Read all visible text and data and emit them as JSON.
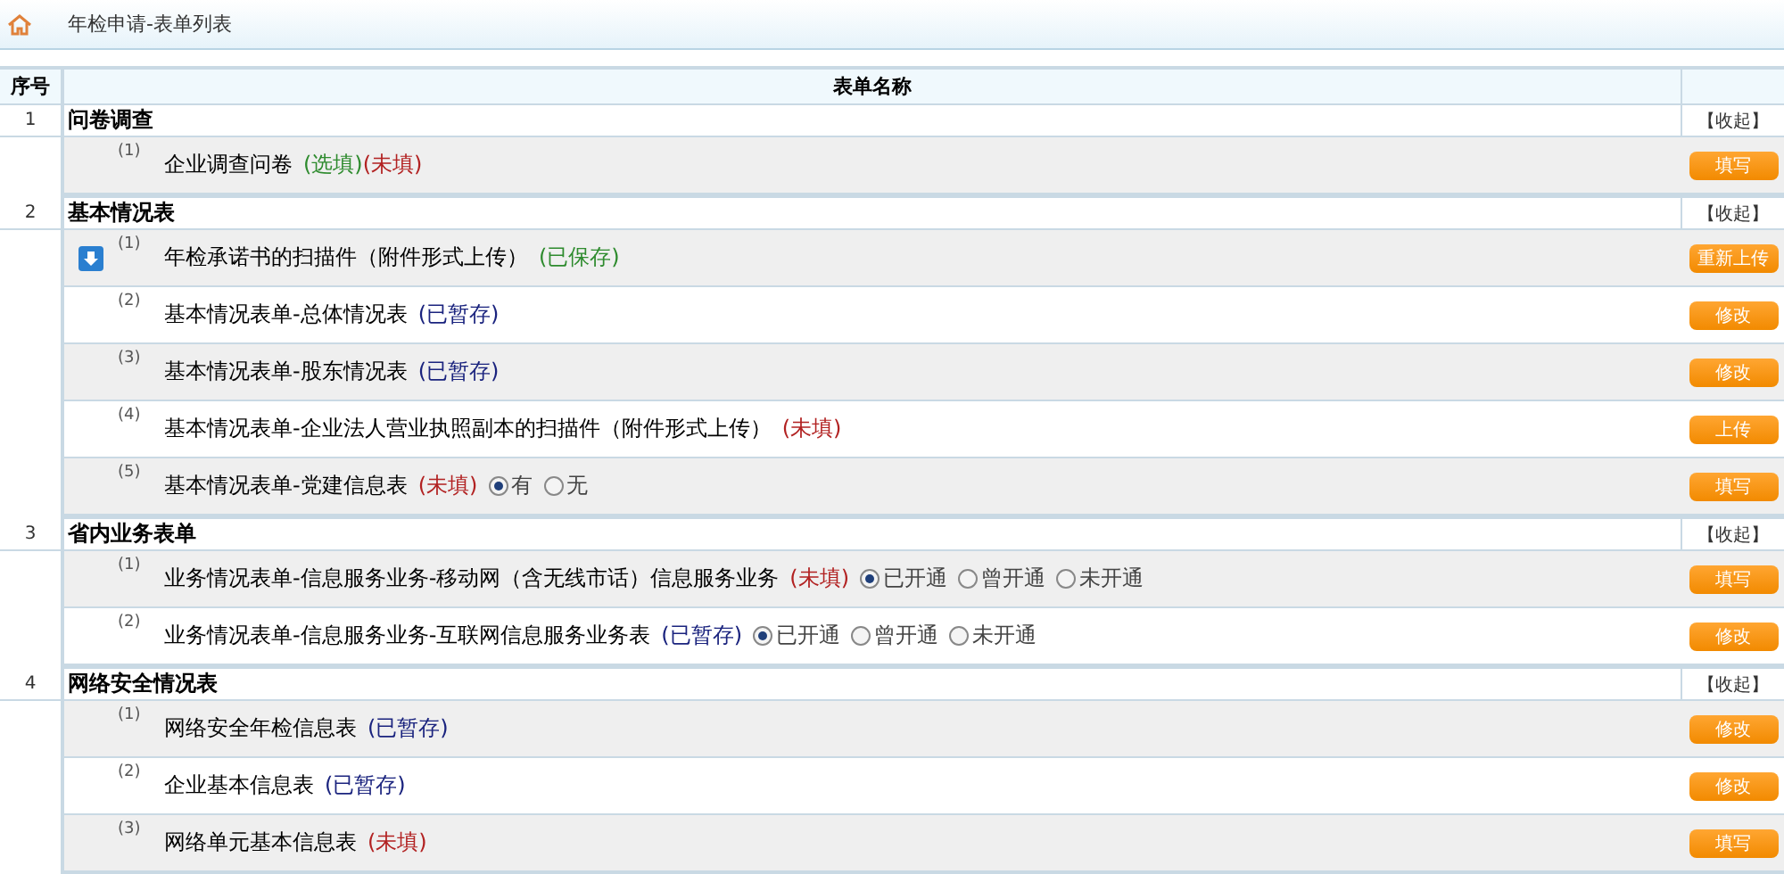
{
  "breadcrumb": "年检申请-表单列表",
  "columns": [
    "序号",
    "表单名称"
  ],
  "groups": [
    {
      "index": "1",
      "title": "问卷调查",
      "toggle": "【收起】",
      "items": [
        {
          "number": "(1)",
          "attachment": false,
          "name": "企业调查问卷",
          "statuses": [
            {
              "text": "(选填)",
              "kind": "optional"
            },
            {
              "text": "(未填)",
              "kind": "unfilled"
            }
          ],
          "action": "填写"
        }
      ]
    },
    {
      "index": "2",
      "title": "基本情况表",
      "toggle": "【收起】",
      "items": [
        {
          "number": "(1)",
          "attachment": true,
          "name": "年检承诺书的扫描件（附件形式上传）",
          "statuses": [
            {
              "text": "(已保存)",
              "kind": "saved"
            }
          ],
          "action": "重新上传"
        },
        {
          "number": "(2)",
          "attachment": false,
          "name": "基本情况表单-总体情况表",
          "statuses": [
            {
              "text": "(已暂存)",
              "kind": "draft"
            }
          ],
          "action": "修改"
        },
        {
          "number": "(3)",
          "attachment": false,
          "name": "基本情况表单-股东情况表",
          "statuses": [
            {
              "text": "(已暂存)",
              "kind": "draft"
            }
          ],
          "action": "修改"
        },
        {
          "number": "(4)",
          "attachment": false,
          "name": "基本情况表单-企业法人营业执照副本的扫描件（附件形式上传）",
          "statuses": [
            {
              "text": "(未填)",
              "kind": "unfilled"
            }
          ],
          "action": "上传"
        },
        {
          "number": "(5)",
          "attachment": false,
          "name": "基本情况表单-党建信息表",
          "statuses": [
            {
              "text": "(未填)",
              "kind": "unfilled"
            }
          ],
          "options": [
            {
              "label": "有",
              "selected": true
            },
            {
              "label": "无",
              "selected": false
            }
          ],
          "action": "填写"
        }
      ]
    },
    {
      "index": "3",
      "title": "省内业务表单",
      "toggle": "【收起】",
      "items": [
        {
          "number": "(1)",
          "attachment": false,
          "name": "业务情况表单-信息服务业务-移动网（含无线市话）信息服务业务",
          "statuses": [
            {
              "text": "(未填)",
              "kind": "unfilled"
            }
          ],
          "options": [
            {
              "label": "已开通",
              "selected": true
            },
            {
              "label": "曾开通",
              "selected": false
            },
            {
              "label": "未开通",
              "selected": false
            }
          ],
          "action": "填写"
        },
        {
          "number": "(2)",
          "attachment": false,
          "name": "业务情况表单-信息服务业务-互联网信息服务业务表",
          "statuses": [
            {
              "text": "(已暂存)",
              "kind": "draft"
            }
          ],
          "options": [
            {
              "label": "已开通",
              "selected": true
            },
            {
              "label": "曾开通",
              "selected": false
            },
            {
              "label": "未开通",
              "selected": false
            }
          ],
          "action": "修改"
        }
      ]
    },
    {
      "index": "4",
      "title": "网络安全情况表",
      "toggle": "【收起】",
      "items": [
        {
          "number": "(1)",
          "attachment": false,
          "name": "网络安全年检信息表",
          "statuses": [
            {
              "text": "(已暂存)",
              "kind": "draft"
            }
          ],
          "action": "修改"
        },
        {
          "number": "(2)",
          "attachment": false,
          "name": "企业基本信息表",
          "statuses": [
            {
              "text": "(已暂存)",
              "kind": "draft"
            }
          ],
          "action": "修改"
        },
        {
          "number": "(3)",
          "attachment": false,
          "name": "网络单元基本信息表",
          "statuses": [
            {
              "text": "(未填)",
              "kind": "unfilled"
            }
          ],
          "action": "填写"
        }
      ]
    }
  ]
}
